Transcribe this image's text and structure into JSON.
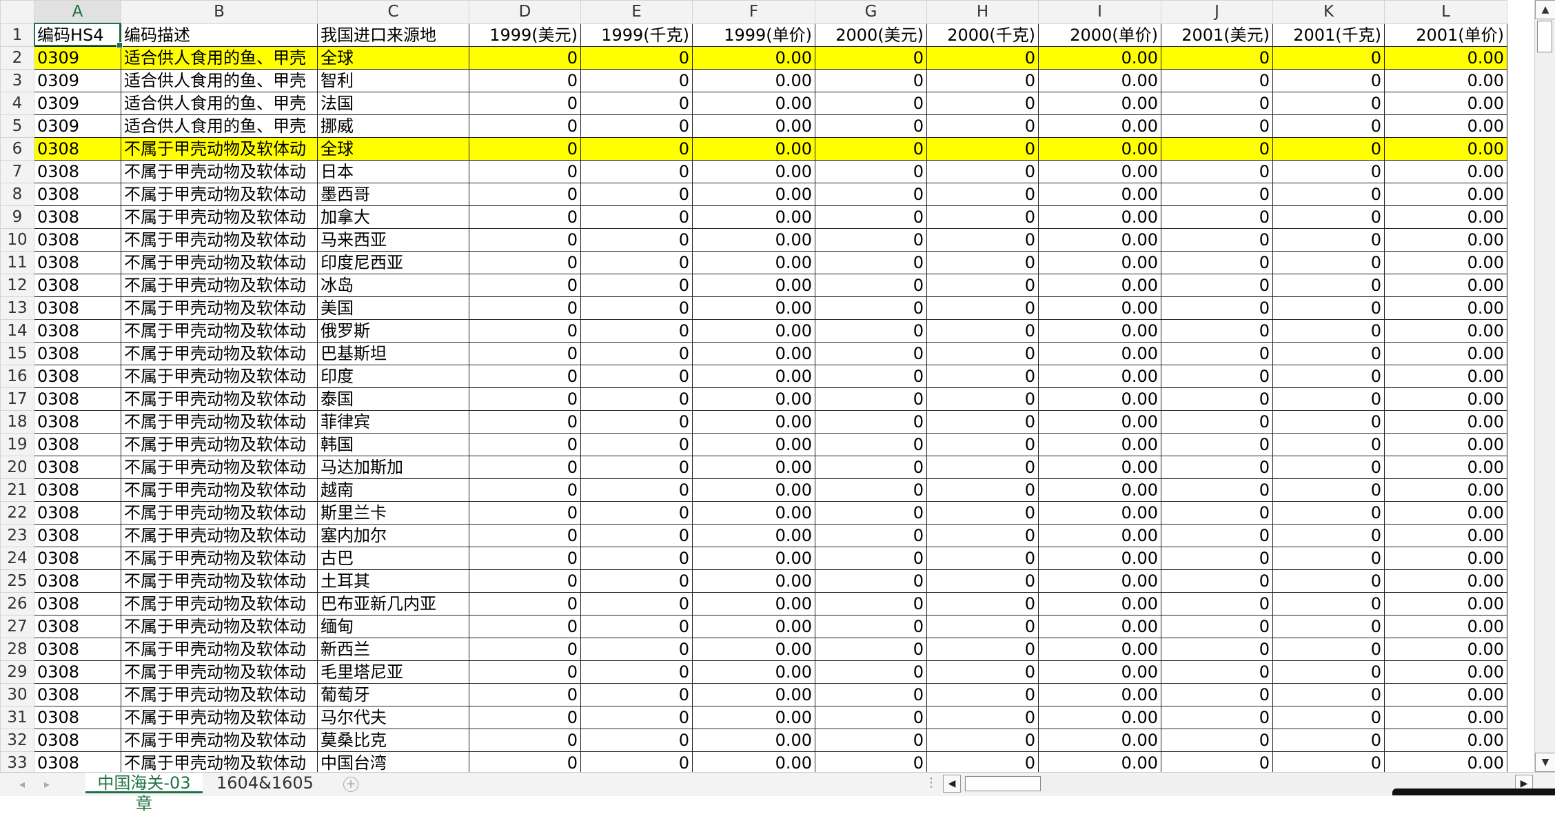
{
  "columns": [
    "A",
    "B",
    "C",
    "D",
    "E",
    "F",
    "G",
    "H",
    "I",
    "J",
    "K",
    "L"
  ],
  "header_row": {
    "row_num": "1",
    "cells": [
      "编码HS4",
      "编码描述",
      "我国进口来源地",
      "1999(美元)",
      "1999(千克)",
      "1999(单价)",
      "2000(美元)",
      "2000(千克)",
      "2000(单价)",
      "2001(美元)",
      "2001(千克)",
      "2001(单价)"
    ]
  },
  "rows": [
    {
      "n": "2",
      "code": "0309",
      "desc": "适合供人食用的鱼、甲壳",
      "origin": "全球",
      "highlight": true
    },
    {
      "n": "3",
      "code": "0309",
      "desc": "适合供人食用的鱼、甲壳",
      "origin": "智利",
      "highlight": false
    },
    {
      "n": "4",
      "code": "0309",
      "desc": "适合供人食用的鱼、甲壳",
      "origin": "法国",
      "highlight": false
    },
    {
      "n": "5",
      "code": "0309",
      "desc": "适合供人食用的鱼、甲壳",
      "origin": "挪威",
      "highlight": false
    },
    {
      "n": "6",
      "code": "0308",
      "desc": "不属于甲壳动物及软体动",
      "origin": "全球",
      "highlight": true
    },
    {
      "n": "7",
      "code": "0308",
      "desc": "不属于甲壳动物及软体动",
      "origin": "日本",
      "highlight": false
    },
    {
      "n": "8",
      "code": "0308",
      "desc": "不属于甲壳动物及软体动",
      "origin": "墨西哥",
      "highlight": false
    },
    {
      "n": "9",
      "code": "0308",
      "desc": "不属于甲壳动物及软体动",
      "origin": "加拿大",
      "highlight": false
    },
    {
      "n": "10",
      "code": "0308",
      "desc": "不属于甲壳动物及软体动",
      "origin": "马来西亚",
      "highlight": false
    },
    {
      "n": "11",
      "code": "0308",
      "desc": "不属于甲壳动物及软体动",
      "origin": "印度尼西亚",
      "highlight": false
    },
    {
      "n": "12",
      "code": "0308",
      "desc": "不属于甲壳动物及软体动",
      "origin": "冰岛",
      "highlight": false
    },
    {
      "n": "13",
      "code": "0308",
      "desc": "不属于甲壳动物及软体动",
      "origin": "美国",
      "highlight": false
    },
    {
      "n": "14",
      "code": "0308",
      "desc": "不属于甲壳动物及软体动",
      "origin": "俄罗斯",
      "highlight": false
    },
    {
      "n": "15",
      "code": "0308",
      "desc": "不属于甲壳动物及软体动",
      "origin": "巴基斯坦",
      "highlight": false
    },
    {
      "n": "16",
      "code": "0308",
      "desc": "不属于甲壳动物及软体动",
      "origin": "印度",
      "highlight": false
    },
    {
      "n": "17",
      "code": "0308",
      "desc": "不属于甲壳动物及软体动",
      "origin": "泰国",
      "highlight": false
    },
    {
      "n": "18",
      "code": "0308",
      "desc": "不属于甲壳动物及软体动",
      "origin": "菲律宾",
      "highlight": false
    },
    {
      "n": "19",
      "code": "0308",
      "desc": "不属于甲壳动物及软体动",
      "origin": "韩国",
      "highlight": false
    },
    {
      "n": "20",
      "code": "0308",
      "desc": "不属于甲壳动物及软体动",
      "origin": "马达加斯加",
      "highlight": false
    },
    {
      "n": "21",
      "code": "0308",
      "desc": "不属于甲壳动物及软体动",
      "origin": "越南",
      "highlight": false
    },
    {
      "n": "22",
      "code": "0308",
      "desc": "不属于甲壳动物及软体动",
      "origin": "斯里兰卡",
      "highlight": false
    },
    {
      "n": "23",
      "code": "0308",
      "desc": "不属于甲壳动物及软体动",
      "origin": "塞内加尔",
      "highlight": false
    },
    {
      "n": "24",
      "code": "0308",
      "desc": "不属于甲壳动物及软体动",
      "origin": "古巴",
      "highlight": false
    },
    {
      "n": "25",
      "code": "0308",
      "desc": "不属于甲壳动物及软体动",
      "origin": "土耳其",
      "highlight": false
    },
    {
      "n": "26",
      "code": "0308",
      "desc": "不属于甲壳动物及软体动",
      "origin": "巴布亚新几内亚",
      "highlight": false
    },
    {
      "n": "27",
      "code": "0308",
      "desc": "不属于甲壳动物及软体动",
      "origin": "缅甸",
      "highlight": false
    },
    {
      "n": "28",
      "code": "0308",
      "desc": "不属于甲壳动物及软体动",
      "origin": "新西兰",
      "highlight": false
    },
    {
      "n": "29",
      "code": "0308",
      "desc": "不属于甲壳动物及软体动",
      "origin": "毛里塔尼亚",
      "highlight": false
    },
    {
      "n": "30",
      "code": "0308",
      "desc": "不属于甲壳动物及软体动",
      "origin": "葡萄牙",
      "highlight": false
    },
    {
      "n": "31",
      "code": "0308",
      "desc": "不属于甲壳动物及软体动",
      "origin": "马尔代夫",
      "highlight": false
    },
    {
      "n": "32",
      "code": "0308",
      "desc": "不属于甲壳动物及软体动",
      "origin": "莫桑比克",
      "highlight": false
    },
    {
      "n": "33",
      "code": "0308",
      "desc": "不属于甲壳动物及软体动",
      "origin": "中国台湾",
      "highlight": false
    }
  ],
  "numeric_values": [
    "0",
    "0",
    "0.00",
    "0",
    "0",
    "0.00",
    "0",
    "0",
    "0.00"
  ],
  "highlight_color": "#ffff00",
  "selected_cell": "A2",
  "sheet_tabs": [
    {
      "label": "中国海关-03章",
      "active": true
    },
    {
      "label": "1604&1605",
      "active": false
    }
  ],
  "icons": {
    "prev": "◂",
    "next": "▸",
    "add": "+",
    "scroll_up": "▲",
    "scroll_down": "▼",
    "scroll_left": "◀",
    "scroll_right": "▶",
    "dots": "⋮"
  }
}
